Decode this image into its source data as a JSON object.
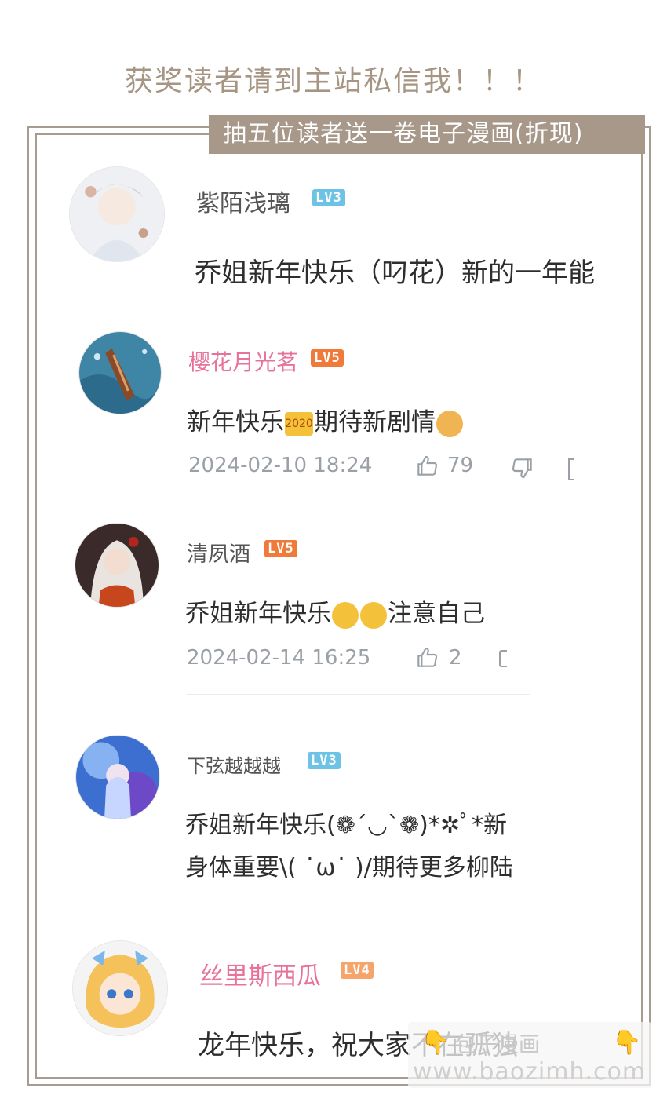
{
  "header_note": "获奖读者请到主站私信我！！！",
  "banner": "抽五位读者送一卷电子漫画(折现)",
  "colors": {
    "frame": "#a79c90",
    "banner_bg": "#a7988a",
    "pink_name": "#e8739a",
    "lv3": "#6cc3e6",
    "lv4": "#f5a46b",
    "lv5": "#f07a3a"
  },
  "comments": [
    {
      "username": "紫陌浅璃",
      "level": "LV3",
      "text": "乔姐新年快乐（叼花）新的一年能"
    },
    {
      "username": "樱花月光茗",
      "level": "LV5",
      "text_before": "新年快乐",
      "emoji_1": "2020",
      "text_after": "期待新剧情",
      "date": "2024-02-10 18:24",
      "likes": "79"
    },
    {
      "username": "清夙酒",
      "level": "LV5",
      "text_before": "乔姐新年快乐",
      "text_after": "注意自己",
      "date": "2024-02-14 16:25",
      "likes": "2"
    },
    {
      "username": "下弦越越越",
      "level": "LV3",
      "line1": "乔姐新年快乐(❁´◡`❁)*✲ﾟ*新",
      "line2": "身体重要\\( ˙ω˙ )/期待更多柳陆"
    },
    {
      "username": "丝里斯西瓜",
      "level": "LV4",
      "text": "龙年快乐，祝大家不在孤独"
    }
  ],
  "watermark": {
    "line1": "包子漫画",
    "url": "www.baozimh.com"
  },
  "icons": [
    "thumbs-up-icon",
    "thumbs-down-icon",
    "hand-pointing-down-icon"
  ]
}
